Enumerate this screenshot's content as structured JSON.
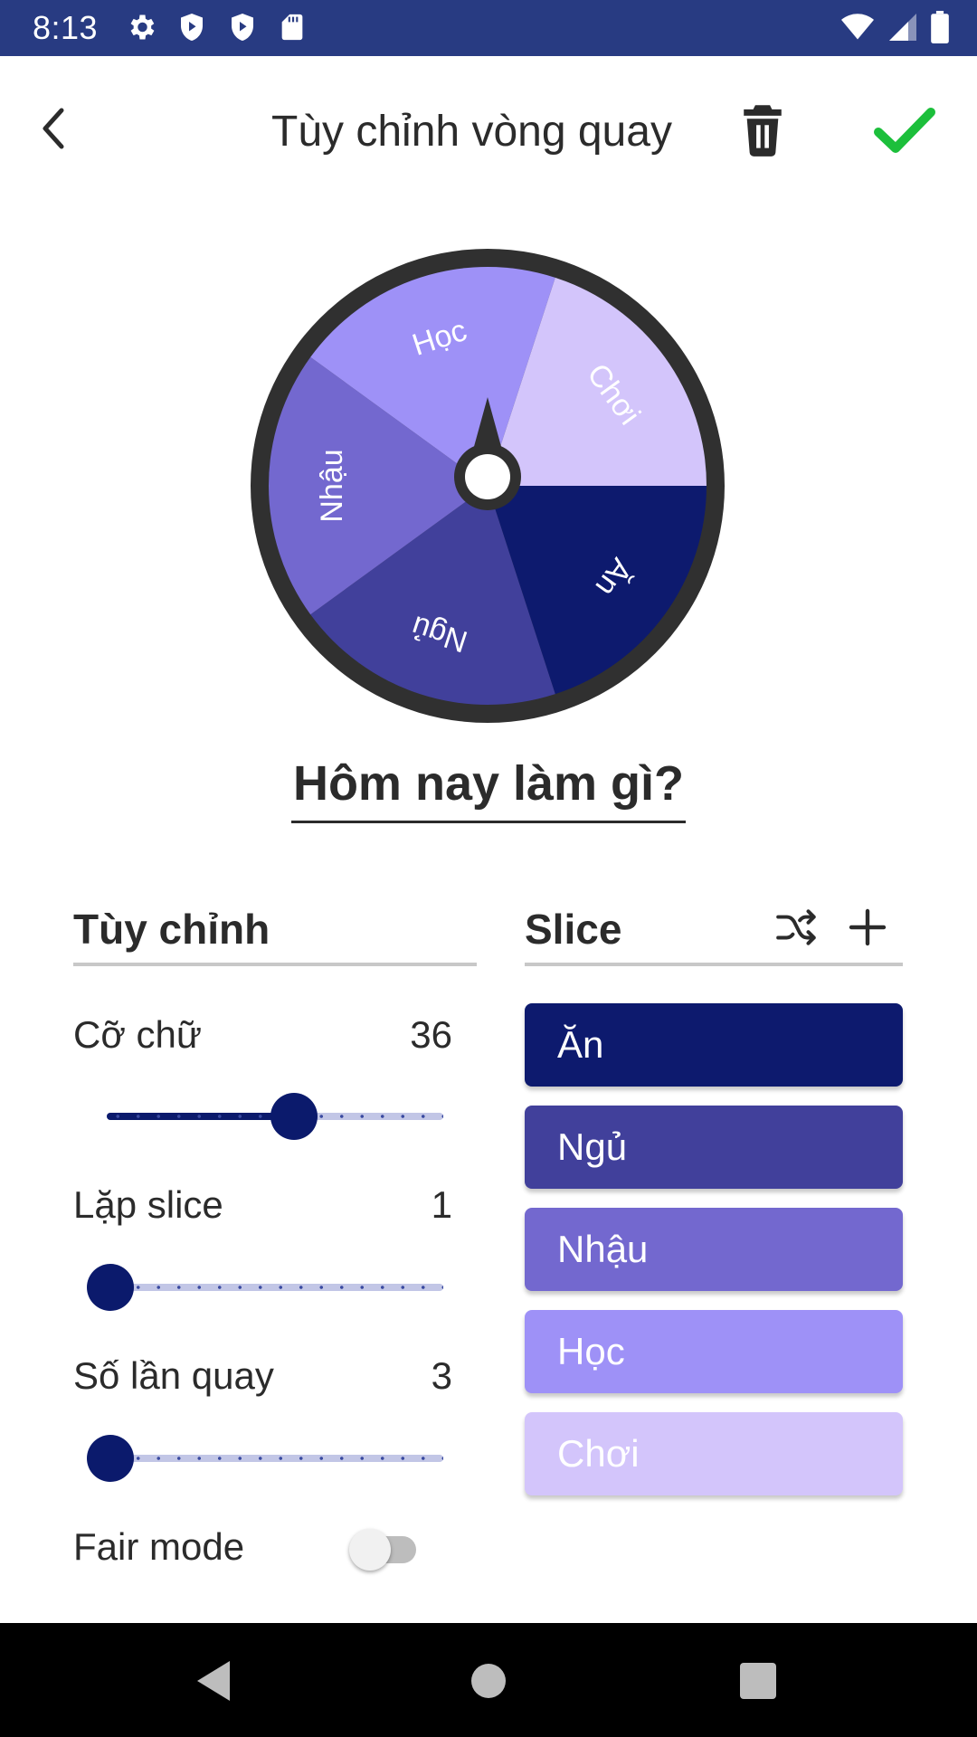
{
  "status_bar": {
    "time": "8:13"
  },
  "app_bar": {
    "title": "Tùy chỉnh vòng quay"
  },
  "wheel": {
    "title": "Hôm nay làm gì?",
    "slices": [
      {
        "label": "Ăn",
        "color": "#0d1a6e"
      },
      {
        "label": "Ngủ",
        "color": "#41409b"
      },
      {
        "label": "Nhậu",
        "color": "#7368cf"
      },
      {
        "label": "Học",
        "color": "#9e91f7"
      },
      {
        "label": "Chơi",
        "color": "#d3c5fb"
      }
    ]
  },
  "customize": {
    "header": "Tùy chỉnh",
    "font_size": {
      "label": "Cỡ chữ",
      "value": "36"
    },
    "repeat_slice": {
      "label": "Lặp slice",
      "value": "1"
    },
    "spin_count": {
      "label": "Số lần quay",
      "value": "3"
    },
    "fair_mode": {
      "label": "Fair mode",
      "on": false
    }
  },
  "slice_panel": {
    "header": "Slice",
    "items": [
      {
        "label": "Ăn",
        "color": "#0d1a6e"
      },
      {
        "label": "Ngủ",
        "color": "#41409b"
      },
      {
        "label": "Nhậu",
        "color": "#7368cf"
      },
      {
        "label": "Học",
        "color": "#9e91f7"
      },
      {
        "label": "Chơi",
        "color": "#d3c5fb"
      }
    ]
  },
  "colors": {
    "accent": "#0b1a6c",
    "confirm": "#1cbf3b",
    "status_bar": "#283b82"
  }
}
